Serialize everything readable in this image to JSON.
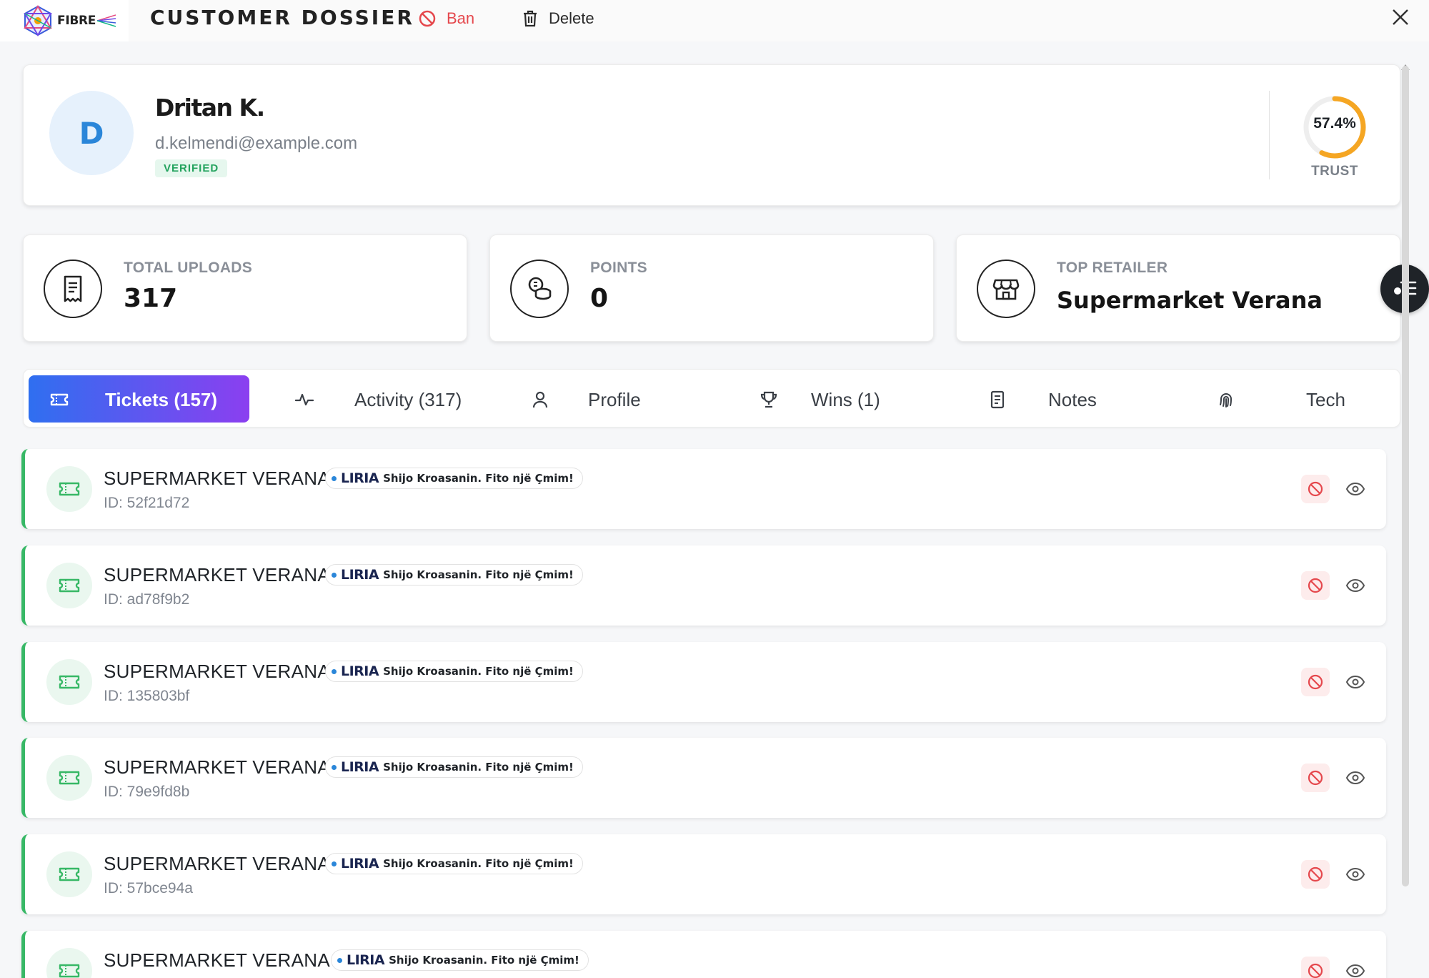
{
  "header": {
    "logo_text": "FIBRE",
    "title": "CUSTOMER DOSSIER",
    "ban_label": "Ban",
    "delete_label": "Delete",
    "icons": [
      "logo-icon",
      "ban-icon",
      "trash-icon",
      "close-icon"
    ]
  },
  "profile": {
    "avatar_initial": "D",
    "name": "Dritan K.",
    "email": "d.kelmendi@example.com",
    "badge": "VERIFIED",
    "trust_value": "57.4%",
    "trust_fraction": 0.574,
    "trust_label": "TRUST"
  },
  "stats": [
    {
      "label": "TOTAL UPLOADS",
      "value": "317",
      "icon": "receipt-icon"
    },
    {
      "label": "POINTS",
      "value": "0",
      "icon": "coins-icon"
    },
    {
      "label": "TOP RETAILER",
      "value": "Supermarket Verana",
      "icon": "store-icon"
    }
  ],
  "tabs": [
    {
      "label": "Tickets (157)",
      "icon": "ticket-icon",
      "active": true
    },
    {
      "label": "Activity (317)",
      "icon": "activity-icon"
    },
    {
      "label": "Profile",
      "icon": "user-icon"
    },
    {
      "label": "Wins (1)",
      "icon": "trophy-icon"
    },
    {
      "label": "Notes",
      "icon": "note-icon"
    },
    {
      "label": "Tech",
      "icon": "fingerprint-icon"
    }
  ],
  "tickets": [
    {
      "store": "SUPERMARKET VERANA",
      "id": "ID: 52f21d72",
      "promo_brand": "LIRIA",
      "promo_text": "Shijo Kroasanin. Fito një Çmim!"
    },
    {
      "store": "SUPERMARKET VERANA",
      "id": "ID: ad78f9b2",
      "promo_brand": "LIRIA",
      "promo_text": "Shijo Kroasanin. Fito një Çmim!"
    },
    {
      "store": "SUPERMARKET VERANA",
      "id": "ID: 135803bf",
      "promo_brand": "LIRIA",
      "promo_text": "Shijo Kroasanin. Fito një Çmim!"
    },
    {
      "store": "SUPERMARKET VERANA",
      "id": "ID: 79e9fd8b",
      "promo_brand": "LIRIA",
      "promo_text": "Shijo Kroasanin. Fito një Çmim!"
    },
    {
      "store": "SUPERMARKET VERANA",
      "id": "ID: 57bce94a",
      "promo_brand": "LIRIA",
      "promo_text": "Shijo Kroasanin. Fito një Çmim!"
    },
    {
      "store": "SUPERMARKET VERANA",
      "id": "",
      "promo_brand": "LIRIA",
      "promo_text": "Shijo Kroasanin. Fito një Çmim!"
    }
  ],
  "colors": {
    "accent_start": "#2f6ff0",
    "accent_end": "#8b3ff0",
    "success": "#37b866",
    "danger": "#e5484d",
    "trust_ring": "#f5a623"
  }
}
